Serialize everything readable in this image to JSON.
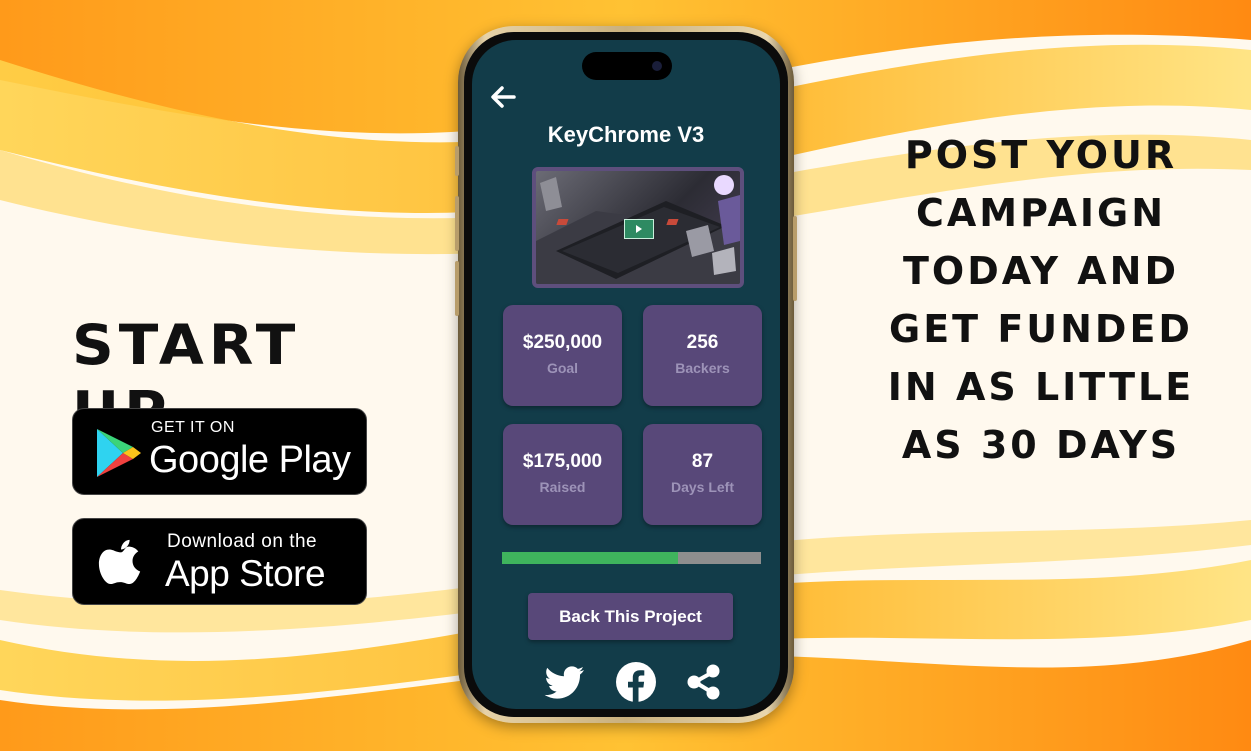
{
  "left": {
    "brand_title": "START UP",
    "google_play": {
      "small": "GET IT ON",
      "large": "Google Play"
    },
    "app_store": {
      "small": "Download on the",
      "large": "App Store"
    }
  },
  "right": {
    "tagline": "POST YOUR CAMPAIGN TODAY AND GET FUNDED IN AS LITTLE AS 30 DAYS"
  },
  "app": {
    "project_title": "KeyChrome V3",
    "stats": [
      {
        "value": "$250,000",
        "label": "Goal"
      },
      {
        "value": "256",
        "label": "Backers"
      },
      {
        "value": "$175,000",
        "label": "Raised"
      },
      {
        "value": "87",
        "label": "Days Left"
      }
    ],
    "progress": 0.68,
    "cta_label": "Back This Project",
    "icons": {
      "back": "arrow-left-icon",
      "share": [
        "twitter-icon",
        "facebook-icon",
        "share-icon"
      ]
    }
  },
  "colors": {
    "screen_bg": "#123c49",
    "card_bg": "#584879",
    "progress_fill": "#3fb45d",
    "progress_track": "#8e8e8e",
    "card_label": "#9d93b8"
  }
}
